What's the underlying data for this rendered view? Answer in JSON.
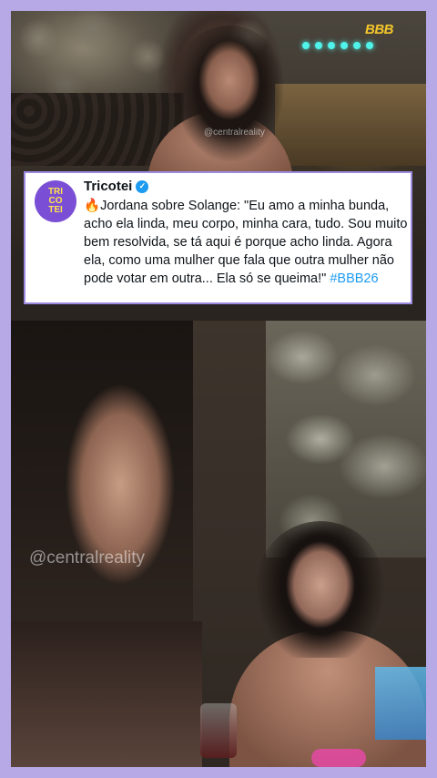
{
  "top_photo": {
    "logo": "BBB",
    "watermark_small": "@centralreality"
  },
  "tweet": {
    "avatar_lines": [
      "TRI",
      "CO",
      "TEI"
    ],
    "account_name": "Tricotei",
    "verified": true,
    "emoji": "🔥",
    "text": "Jordana sobre Solange: \"Eu amo a minha bunda, acho ela linda, meu corpo, minha cara, tudo. Sou muito bem resolvida, se tá aqui é porque acho linda. Agora ela, como uma mulher que fala que outra mulher não pode votar em outra... Ela só se queima!\"",
    "hashtag": "#BBB26"
  },
  "bottom_photo": {
    "watermark": "@centralreality"
  },
  "colors": {
    "border_lavender": "#b7a9e6",
    "tweet_border": "#9c8be0",
    "hashtag_blue": "#1d9bf0",
    "avatar_purple": "#7a4fd6",
    "avatar_yellow": "#ffe14d"
  }
}
